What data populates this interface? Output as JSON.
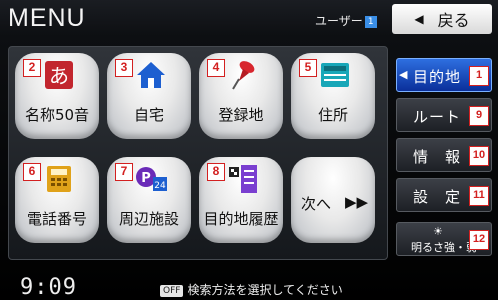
{
  "header": {
    "title": "MENU",
    "user_label": "ユーザー",
    "user_number": "1",
    "back_label": "戻る"
  },
  "tiles": [
    {
      "num": "2",
      "label": "名称50音",
      "icon": "hiragana-a-icon"
    },
    {
      "num": "3",
      "label": "自宅",
      "icon": "home-icon"
    },
    {
      "num": "4",
      "label": "登録地",
      "icon": "pushpin-icon"
    },
    {
      "num": "5",
      "label": "住所",
      "icon": "address-card-icon"
    },
    {
      "num": "6",
      "label": "電話番号",
      "icon": "telephone-icon"
    },
    {
      "num": "7",
      "label": "周辺施設",
      "icon": "parking-24-icon"
    },
    {
      "num": "8",
      "label": "目的地履歴",
      "icon": "history-checklist-icon"
    },
    {
      "label": "次へ",
      "arrows": "▶▶"
    }
  ],
  "side": [
    {
      "num": "1",
      "label": "目的地",
      "active": true
    },
    {
      "num": "9",
      "label": "ルート"
    },
    {
      "num": "10",
      "label": "情　報"
    },
    {
      "num": "11",
      "label": "設　定"
    },
    {
      "num": "12",
      "label": "明るさ強・弱",
      "icon": "sun-icon"
    }
  ],
  "footer": {
    "time": "9:09",
    "off_tag": "OFF",
    "status_text": "検索方法を選択してください"
  },
  "colors": {
    "accent": "#2e6fe0",
    "badge_red": "#d32020"
  }
}
